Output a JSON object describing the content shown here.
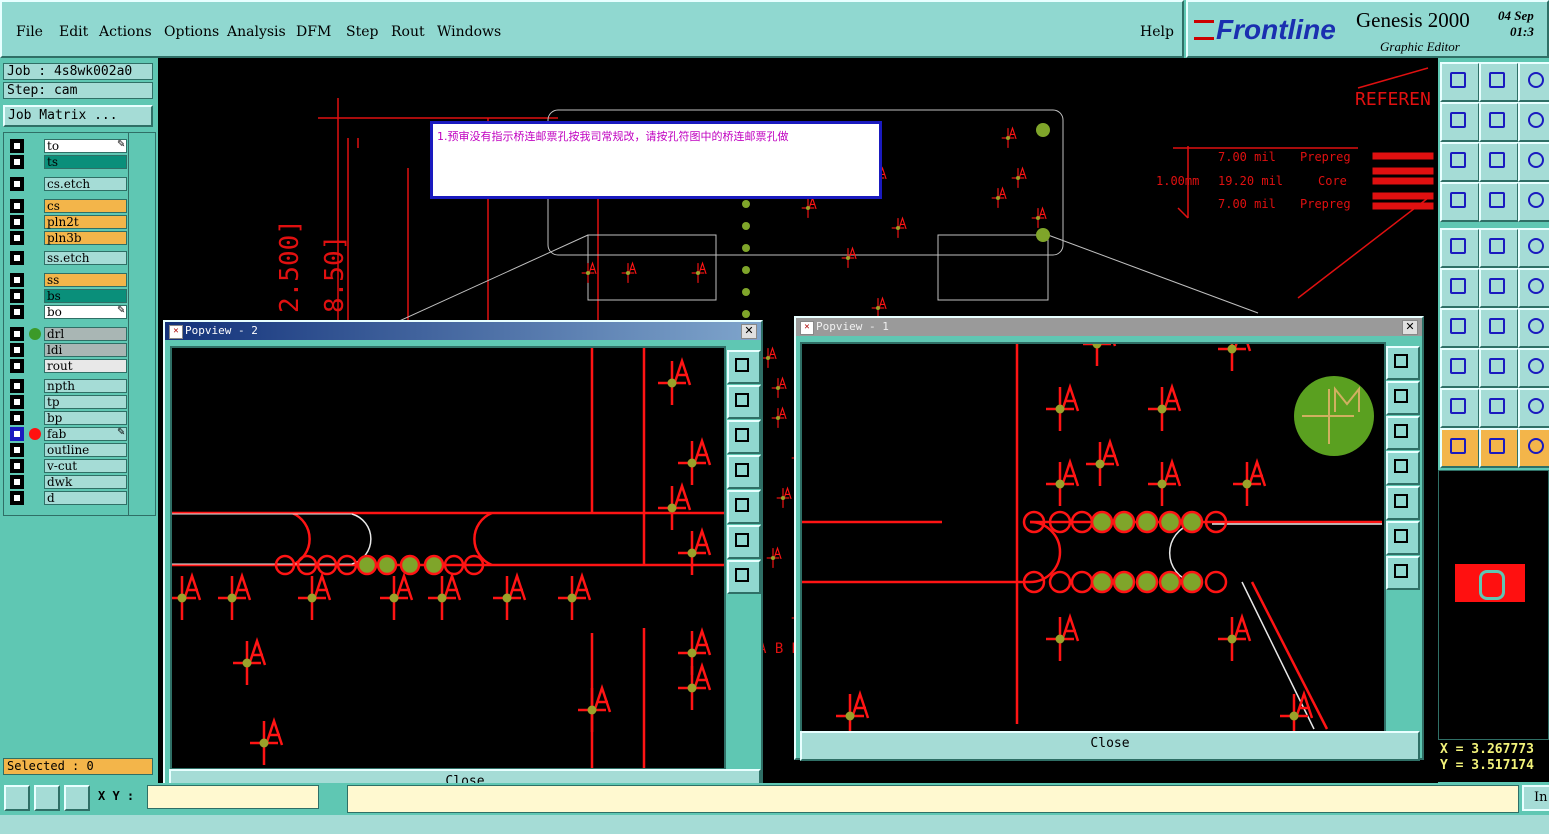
{
  "menu": {
    "items": [
      "File",
      "Edit",
      "Actions",
      "Options",
      "Analysis",
      "DFM",
      "Step",
      "Rout",
      "Windows"
    ],
    "help": "Help"
  },
  "brand": {
    "logo": "Frontline",
    "title": "Genesis 2000",
    "subtitle": "Graphic Editor",
    "date": "04 Sep",
    "time": "01:3"
  },
  "job": {
    "job_label": "Job : 4s8wk002a0",
    "step_label": "Step: cam",
    "matrix_button": "Job Matrix ..."
  },
  "layers": [
    {
      "name": "to",
      "color": "#ffffff",
      "dot": "",
      "edit": true
    },
    {
      "name": "ts",
      "color": "#0a8f7a",
      "dot": "",
      "edit": false
    },
    {
      "name": "cs.etch",
      "color": "#a5dcd6",
      "dot": "",
      "edit": false
    },
    {
      "name": "cs",
      "color": "#f3b54a",
      "dot": "",
      "edit": false
    },
    {
      "name": "pln2t",
      "color": "#f3b54a",
      "dot": "",
      "edit": false
    },
    {
      "name": "pln3b",
      "color": "#f3b54a",
      "dot": "",
      "edit": false
    },
    {
      "name": "ss.etch",
      "color": "#a5dcd6",
      "dot": "",
      "edit": false
    },
    {
      "name": "ss",
      "color": "#f3b54a",
      "dot": "",
      "edit": false
    },
    {
      "name": "bs",
      "color": "#0a8f7a",
      "dot": "",
      "edit": false
    },
    {
      "name": "bo",
      "color": "#ffffff",
      "dot": "",
      "edit": true
    },
    {
      "name": "drl",
      "color": "#a9b6b4",
      "dot": "#3c9a28",
      "edit": false
    },
    {
      "name": "ldi",
      "color": "#a9b6b4",
      "dot": "",
      "edit": false
    },
    {
      "name": "rout",
      "color": "#e8e8e8",
      "dot": "",
      "edit": false
    },
    {
      "name": "npth",
      "color": "#a5dcd6",
      "dot": "",
      "edit": false
    },
    {
      "name": "tp",
      "color": "#a5dcd6",
      "dot": "",
      "edit": false
    },
    {
      "name": "bp",
      "color": "#a5dcd6",
      "dot": "",
      "edit": false
    },
    {
      "name": "fab",
      "color": "#a5dcd6",
      "dot": "#ff1010",
      "edit": true
    },
    {
      "name": "outline",
      "color": "#a5dcd6",
      "dot": "",
      "edit": false
    },
    {
      "name": "v-cut",
      "color": "#a5dcd6",
      "dot": "",
      "edit": false
    },
    {
      "name": "dwk",
      "color": "#a5dcd6",
      "dot": "",
      "edit": false
    },
    {
      "name": "d",
      "color": "#a5dcd6",
      "dot": "",
      "edit": false
    }
  ],
  "selected": "Selected : 0",
  "note": "1.预审没有指示桥连邮票孔按我司常规改，请按孔符图中的桥连邮票孔做",
  "drawing": {
    "reference": "REFEREN",
    "stack": [
      {
        "left": "7.00 mil",
        "right": "Prepreg"
      },
      {
        "left": "19.20 mil",
        "right": "Core"
      },
      {
        "left": "7.00 mil",
        "right": "Prepreg"
      }
    ],
    "thickness": "1.00mm",
    "dim1": "2.500]",
    "dim2": "8.50]",
    "dim3": "A B D"
  },
  "popview2": {
    "title": "Popview - 2",
    "close": "Close"
  },
  "popview1": {
    "title": "Popview - 1",
    "close": "Close"
  },
  "coords": {
    "x": "X = 3.267773",
    "y": "Y = 3.517174"
  },
  "status": {
    "xy_label": "X Y :",
    "right_btn": "In"
  },
  "colors": {
    "panel": "#5fc7b3",
    "canvas": "#000000",
    "trace": "#ff1414",
    "pad": "#7fa52a"
  }
}
